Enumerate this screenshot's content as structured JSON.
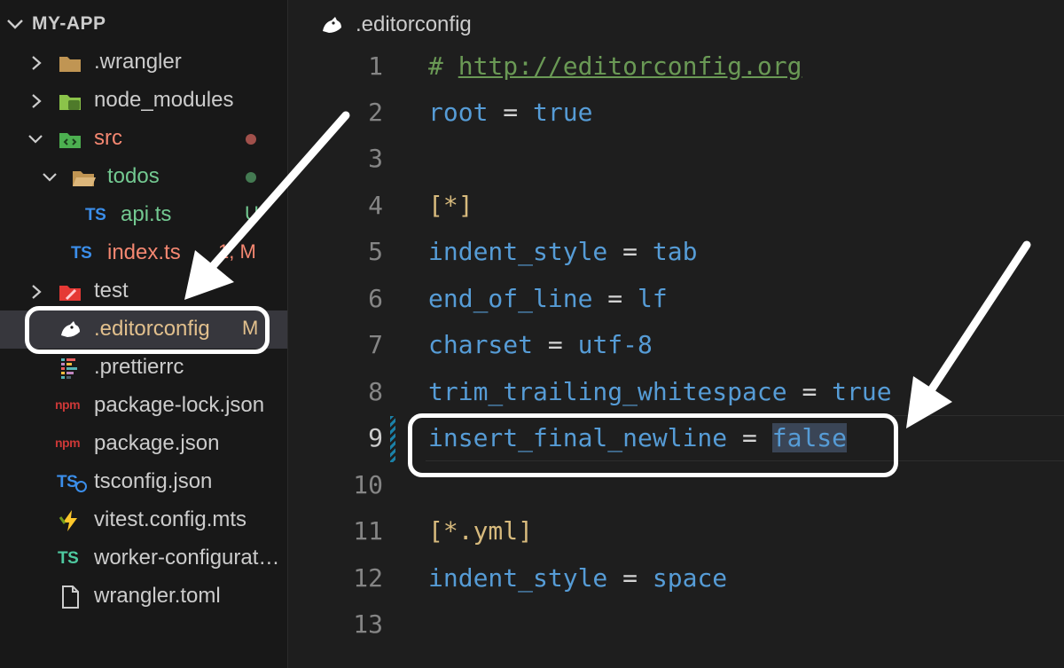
{
  "sidebar": {
    "root_label": "MY-APP",
    "items": [
      {
        "label": ".wrangler",
        "icon": "folder-icon"
      },
      {
        "label": "node_modules",
        "icon": "node-modules-folder-icon"
      },
      {
        "label": "src",
        "icon": "src-folder-icon"
      },
      {
        "label": "todos",
        "icon": "folder-open-icon"
      },
      {
        "label": "api.ts",
        "icon": "typescript-icon",
        "icon_text": "TS",
        "badge": "U"
      },
      {
        "label": "index.ts",
        "icon": "typescript-icon",
        "icon_text": "TS",
        "badge": "1, M"
      },
      {
        "label": "test",
        "icon": "test-folder-icon"
      },
      {
        "label": ".editorconfig",
        "icon": "editorconfig-icon",
        "badge": "M"
      },
      {
        "label": ".prettierrc",
        "icon": "prettier-icon"
      },
      {
        "label": "package-lock.json",
        "icon": "npm-icon",
        "icon_text": "npm"
      },
      {
        "label": "package.json",
        "icon": "npm-icon",
        "icon_text": "npm"
      },
      {
        "label": "tsconfig.json",
        "icon": "tsconfig-icon",
        "icon_text": "TS"
      },
      {
        "label": "vitest.config.mts",
        "icon": "vitest-icon"
      },
      {
        "label": "worker-configuration.d.ts",
        "icon": "typescript-def-icon",
        "icon_text": "TS"
      },
      {
        "label": "wrangler.toml",
        "icon": "file-icon"
      }
    ]
  },
  "editor": {
    "tab_label": ".editorconfig",
    "lines": [
      {
        "num": "1",
        "comment": "#",
        "link": "http://editorconfig.org"
      },
      {
        "num": "2",
        "key": "root",
        "op": "=",
        "value": "true"
      },
      {
        "num": "3"
      },
      {
        "num": "4",
        "section": "[*]"
      },
      {
        "num": "5",
        "key": "indent_style",
        "op": "=",
        "value": "tab"
      },
      {
        "num": "6",
        "key": "end_of_line",
        "op": "=",
        "value": "lf"
      },
      {
        "num": "7",
        "key": "charset",
        "op": "=",
        "value": "utf-8"
      },
      {
        "num": "8",
        "key": "trim_trailing_whitespace",
        "op": "=",
        "value": "true"
      },
      {
        "num": "9",
        "key": "insert_final_newline",
        "op": "=",
        "value": "false"
      },
      {
        "num": "10"
      },
      {
        "num": "11",
        "section": "[*.yml]"
      },
      {
        "num": "12",
        "key": "indent_style",
        "op": "=",
        "value": "space"
      },
      {
        "num": "13"
      }
    ]
  },
  "colors": {
    "modified": "#e2c08d",
    "untracked": "#73c991",
    "error": "#f48771",
    "accent": "#569cd6"
  }
}
